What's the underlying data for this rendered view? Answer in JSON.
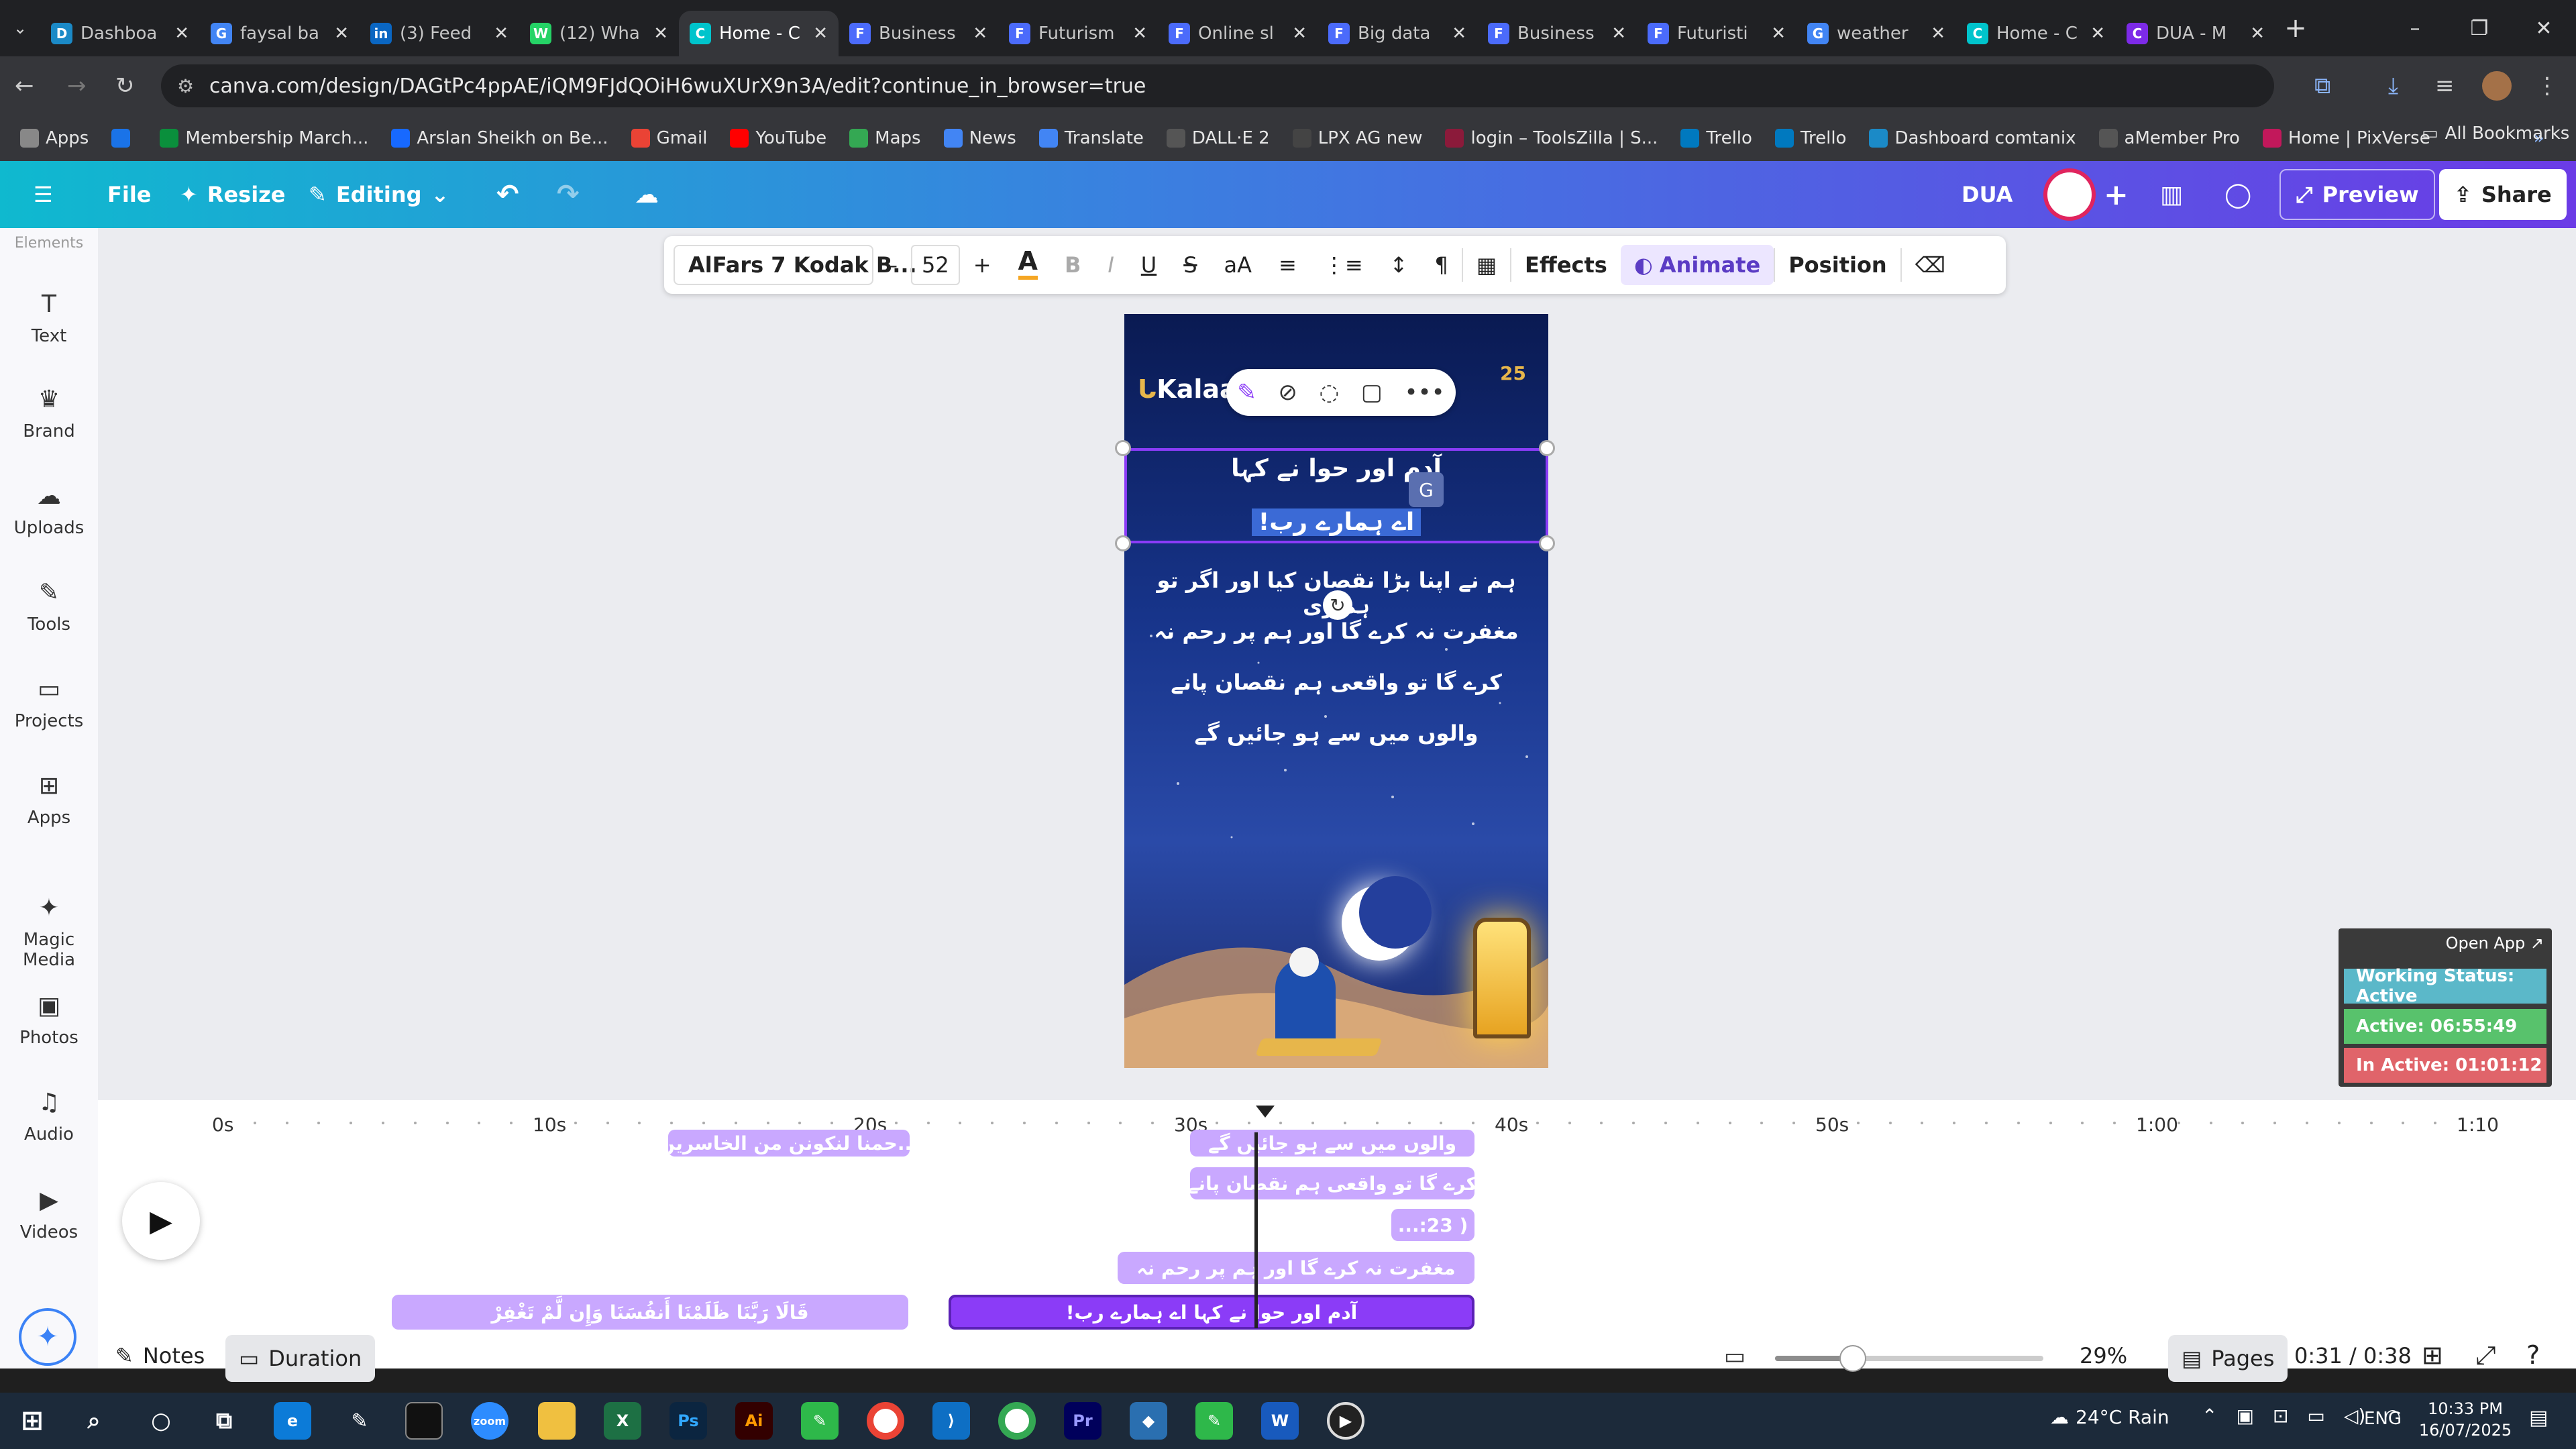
{
  "browser": {
    "tabs": [
      {
        "title": "Dashboa",
        "color": "#1b8ac7",
        "letter": "D"
      },
      {
        "title": "faysal ba",
        "color": "#4285f4",
        "letter": "G"
      },
      {
        "title": "(3) Feed",
        "color": "#0a66c2",
        "letter": "in"
      },
      {
        "title": "(12) Wha",
        "color": "#25d366",
        "letter": "W"
      },
      {
        "title": "Home - C",
        "color": "#00c4cc",
        "letter": "C"
      },
      {
        "title": "Business",
        "color": "#4b6bfb",
        "letter": "F"
      },
      {
        "title": "Futurism",
        "color": "#4b6bfb",
        "letter": "F"
      },
      {
        "title": "Online sl",
        "color": "#4b6bfb",
        "letter": "F"
      },
      {
        "title": "Big data",
        "color": "#4b6bfb",
        "letter": "F"
      },
      {
        "title": "Business",
        "color": "#4b6bfb",
        "letter": "F"
      },
      {
        "title": "Futuristi",
        "color": "#4b6bfb",
        "letter": "F"
      },
      {
        "title": "weather",
        "color": "#4285f4",
        "letter": "G"
      },
      {
        "title": "Home - C",
        "color": "#00c4cc",
        "letter": "C"
      },
      {
        "title": "DUA - M",
        "color": "#7d2ae8",
        "letter": "C"
      }
    ],
    "new_tab_label": "+",
    "url": "canva.com/design/DAGtPc4ppAE/iQM9FJdQOiH6wuXUrX9n3A/edit?continue_in_browser=true",
    "bookmarks": [
      {
        "label": "Apps",
        "color": "#888"
      },
      {
        "label": "",
        "color": "#1a73e8"
      },
      {
        "label": "Membership March...",
        "color": "#0a8f3c"
      },
      {
        "label": "Arslan Sheikh on Be...",
        "color": "#1769ff"
      },
      {
        "label": "Gmail",
        "color": "#ea4335"
      },
      {
        "label": "YouTube",
        "color": "#ff0000"
      },
      {
        "label": "Maps",
        "color": "#34a853"
      },
      {
        "label": "News",
        "color": "#4285f4"
      },
      {
        "label": "Translate",
        "color": "#4285f4"
      },
      {
        "label": "DALL·E 2",
        "color": "#555"
      },
      {
        "label": "LPX AG new",
        "color": "#444"
      },
      {
        "label": "login – ToolsZilla | S...",
        "color": "#8b1a3a"
      },
      {
        "label": "Trello",
        "color": "#0079bf"
      },
      {
        "label": "Trello",
        "color": "#0079bf"
      },
      {
        "label": "Dashboard comtanix",
        "color": "#1b8ac7"
      },
      {
        "label": "aMember Pro",
        "color": "#555"
      },
      {
        "label": "Home | PixVerse",
        "color": "#c2185b"
      }
    ],
    "all_bookmarks_label": "All Bookmarks"
  },
  "canva_header": {
    "file_label": "File",
    "resize_label": "Resize",
    "editing_label": "Editing",
    "design_name": "DUA",
    "preview_label": "Preview",
    "share_label": "Share"
  },
  "side_panel": {
    "items": [
      {
        "label": "Elements",
        "icon": "elements-icon",
        "glyph": ""
      },
      {
        "label": "Text",
        "icon": "text-icon",
        "glyph": "T"
      },
      {
        "label": "Brand",
        "icon": "brand-icon",
        "glyph": "♛"
      },
      {
        "label": "Uploads",
        "icon": "uploads-icon",
        "glyph": "☁"
      },
      {
        "label": "Tools",
        "icon": "tools-icon",
        "glyph": "✎"
      },
      {
        "label": "Projects",
        "icon": "projects-icon",
        "glyph": "▭"
      },
      {
        "label": "Apps",
        "icon": "apps-icon",
        "glyph": "⊞"
      },
      {
        "label": "Magic Media",
        "icon": "magic-media-icon",
        "glyph": "✦"
      },
      {
        "label": "Photos",
        "icon": "photos-icon",
        "glyph": "▣"
      },
      {
        "label": "Audio",
        "icon": "audio-icon",
        "glyph": "♫"
      },
      {
        "label": "Videos",
        "icon": "videos-icon",
        "glyph": "▶"
      }
    ]
  },
  "text_toolbar": {
    "font_name": "AlFars 7 Kodak B...",
    "font_size": "52",
    "minus": "–",
    "plus": "+",
    "effects_label": "Effects",
    "animate_label": "Animate",
    "position_label": "Position"
  },
  "design": {
    "brand": "Kalaa",
    "badge_number": "25",
    "heading_line1": "آدم اور حوا نے کہا",
    "heading_line2": "اے ہمارے رب!",
    "body_lines": [
      "ہم نے اپنا بڑا نقصان کیا اور اگر تو ہماری",
      "مغفرت نہ کرے گا اور ہم پر رحم نہ",
      "کرے گا تو واقعی ہم نقصان پانے",
      "والوں میں سے ہو جائیں گے"
    ]
  },
  "timeline": {
    "ticks": [
      "0s",
      "10s",
      "20s",
      "30s",
      "40s",
      "50s",
      "1:00",
      "1:10"
    ],
    "clips": [
      {
        "label": "...حمنا لنكونن من الخاسرين"
      },
      {
        "label": "والوں میں سے ہو جائیں گے"
      },
      {
        "label": "کرے گا تو واقعی ہم نقصان پانے"
      },
      {
        "label": "( 23:..."
      },
      {
        "label": "مغفرت نہ کرے گا اور ہم پر رحم نہ"
      },
      {
        "label": "قَالَا رَبَّنَا ظَلَمْنَا أَنفُسَنَا وَإِن لَّمْ تَغْفِرْ"
      },
      {
        "label": "آدم اور حوا نے کہا اے ہمارے رب!"
      }
    ],
    "notes_label": "Notes",
    "duration_label": "Duration",
    "zoom_percent": "29%",
    "zoom_fraction": 0.29,
    "pages_label": "Pages",
    "time_readout": "0:31 / 0:38"
  },
  "work_status": {
    "open_app": "Open App ↗",
    "status": "Working Status: Active",
    "active": "Active: 06:55:49",
    "inactive": "In Active: 01:01:12",
    "colors": {
      "status": "#5bb8c9",
      "active": "#58c26c",
      "inactive": "#e0646a"
    }
  },
  "taskbar": {
    "weather": "24°C  Rain",
    "lang": "ENG",
    "time": "10:33 PM",
    "date": "16/07/2025"
  }
}
